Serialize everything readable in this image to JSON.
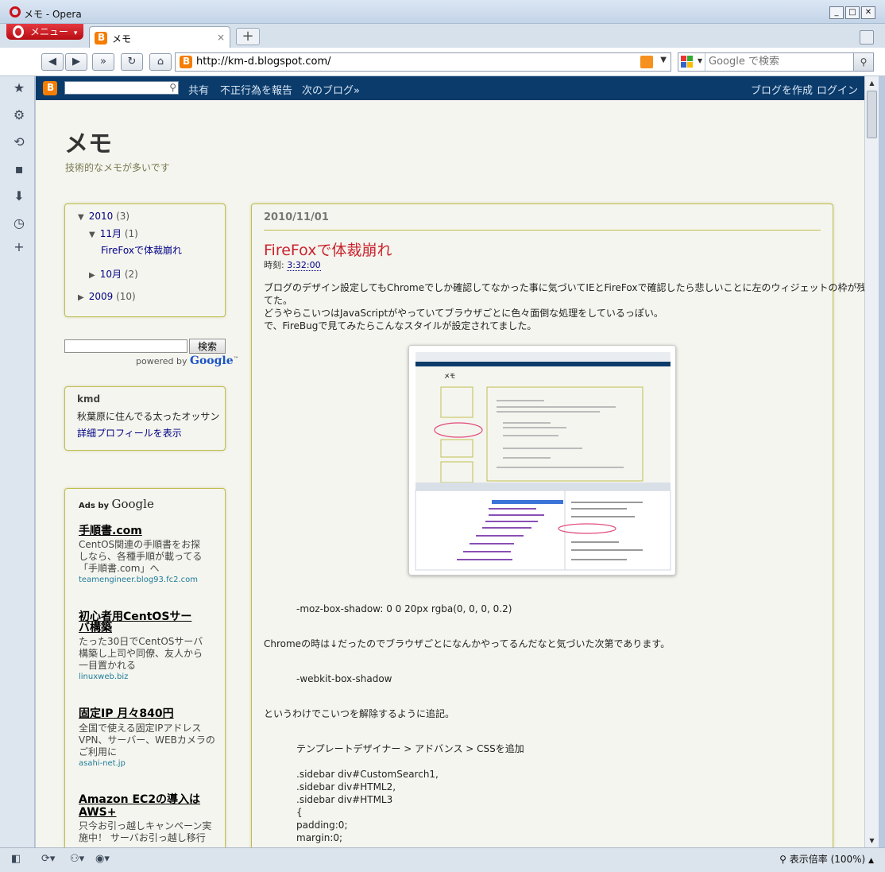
{
  "window": {
    "title": "メモ - Opera"
  },
  "menu": {
    "label": "メニュー"
  },
  "tab": {
    "label": "メモ",
    "close": "×"
  },
  "newtab": "+",
  "nav": {
    "url": "http://km-d.blogspot.com/",
    "search_placeholder": "Google で検索"
  },
  "blogger_nav": {
    "share": "共有",
    "report": "不正行為を報告",
    "next": "次のブログ»",
    "create": "ブログを作成",
    "login": "ログイン"
  },
  "blog": {
    "title": "メモ",
    "description": "技術的なメモが多いです"
  },
  "archive": {
    "y2010": "2010",
    "y2010_count": "(3)",
    "m11": "11月",
    "m11_count": "(1)",
    "post": "FireFoxで体裁崩れ",
    "m10": "10月",
    "m10_count": "(2)",
    "y2009": "2009",
    "y2009_count": "(10)"
  },
  "gsearch": {
    "button": "検索",
    "powered_prefix": "powered by",
    "powered_brand": "Google"
  },
  "profile": {
    "name": "kmd",
    "desc": "秋葉原に住んでる太ったオッサン",
    "link": "詳細プロフィールを表示"
  },
  "ads": {
    "header_prefix": "Ads by",
    "header_brand": "Google",
    "items": [
      {
        "title": "手順書.com",
        "body": [
          "CentOS関連の手順書をお探",
          "しなら、各種手順が載ってる",
          "「手順書.com」へ"
        ],
        "url": "teamengineer.blog93.fc2.com"
      },
      {
        "title_lines": [
          "初心者用CentOSサー",
          "バ構築"
        ],
        "body": [
          "たった30日でCentOSサーバ",
          "構築し上司や同僚、友人から",
          "一目置かれる"
        ],
        "url": "linuxweb.biz"
      },
      {
        "title": "固定IP 月々840円",
        "body": [
          "全国で使える固定IPアドレス",
          "VPN、サーバー、WEBカメラの",
          "ご利用に"
        ],
        "url": "asahi-net.jp"
      },
      {
        "title_lines": [
          "Amazon EC2の導入は",
          "AWS+"
        ],
        "body": [
          "只今お引っ越しキャンペーン実",
          "施中！ サーバお引っ越し移行"
        ]
      }
    ]
  },
  "post": {
    "date": "2010/11/01",
    "title": "FireFoxで体裁崩れ",
    "time_label": "時刻:",
    "time": "3:32:00",
    "para1": [
      "ブログのデザイン設定してもChromeでしか確認してなかった事に気づいてIEとFireFoxで確認したら悲しいことに左のウィジェットの枠が残っ",
      "てた。",
      "どうやらこいつはJavaScriptがやっていてブラウザごとに色々面倒な処理をしているっぽい。",
      "で、FireBugで見てみたらこんなスタイルが設定されてました。"
    ],
    "code1": "-moz-box-shadow: 0 0 20px rgba(0, 0, 0, 0.2)",
    "para2": "Chromeの時は↓だったのでブラウザごとになんかやってるんだなと気づいた次第であります。",
    "code2": "-webkit-box-shadow",
    "para3": "というわけでこいつを解除するように追記。",
    "code3": [
      "テンプレートデザイナー > アドバンス > CSSを追加",
      "",
      ".sidebar div#CustomSearch1,",
      ".sidebar div#HTML2,",
      ".sidebar div#HTML3",
      "{",
      "padding:0;",
      "margin:0;"
    ]
  },
  "status": {
    "zoom": "表示倍率 (100%)"
  }
}
